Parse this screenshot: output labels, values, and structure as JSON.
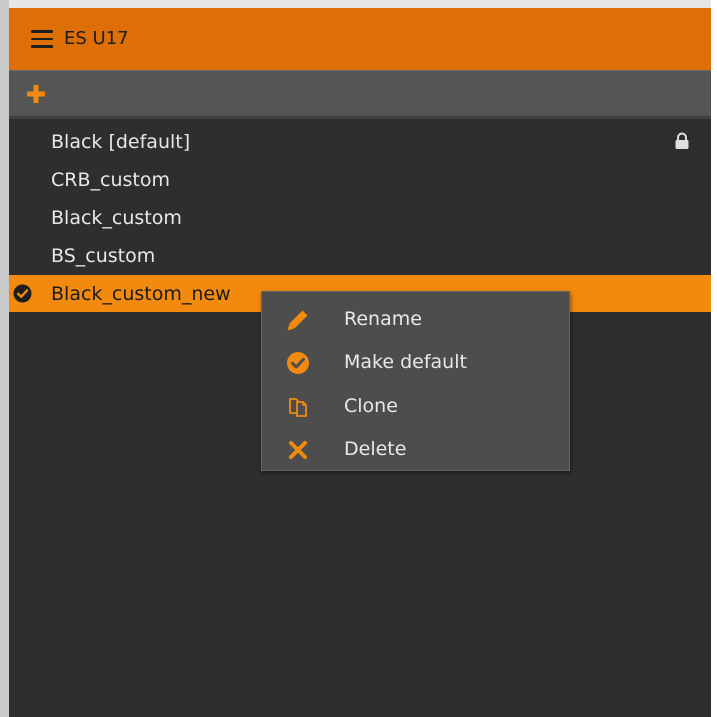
{
  "header": {
    "title": "ES U17",
    "menu_icon": "hamburger-menu-icon"
  },
  "toolbar": {
    "add_icon": "plus-icon"
  },
  "profiles": {
    "items": [
      {
        "label": "Black [default]",
        "locked": true
      },
      {
        "label": "CRB_custom"
      },
      {
        "label": "Black_custom"
      },
      {
        "label": "BS_custom"
      },
      {
        "label": "Black_custom_new",
        "selected": true
      }
    ]
  },
  "context_menu": {
    "items": [
      {
        "label": "Rename",
        "icon": "pencil-icon"
      },
      {
        "label": "Make default",
        "icon": "check-circle-icon"
      },
      {
        "label": "Clone",
        "icon": "clone-icon"
      },
      {
        "label": "Delete",
        "icon": "x-icon"
      }
    ]
  },
  "colors": {
    "accent": "#f28a0f",
    "title_bar": "#dd6f06",
    "panel_bg": "#2e2e2e",
    "toolbar_bg": "#555555",
    "menu_bg": "#4d4d4d"
  }
}
